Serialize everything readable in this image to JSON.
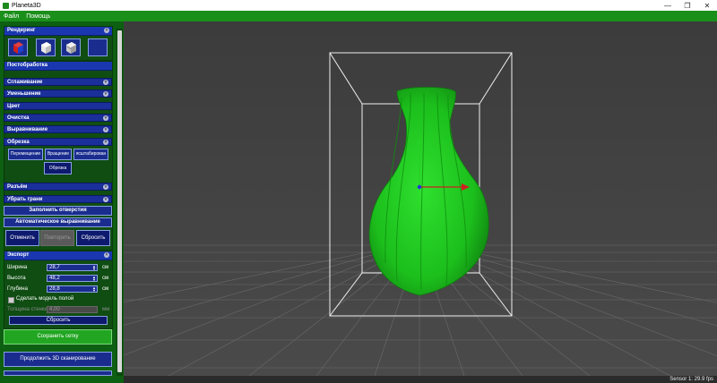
{
  "window": {
    "title": "Planeta3D",
    "minimize": "—",
    "maximize": "❐",
    "close": "✕"
  },
  "menu": {
    "items": [
      "Файл",
      "Помощь"
    ]
  },
  "render": {
    "header": "Рендеринг",
    "icons": [
      "cube-red-blue-icon",
      "cube-white-icon",
      "cube-textured-icon",
      "blank-square-icon"
    ]
  },
  "postprocess": {
    "header": "Постобработка"
  },
  "sections": {
    "smoothing": "Сглаживание",
    "reduction": "Уменьшение",
    "color": "Цвет",
    "cleanup": "Очистка",
    "alignment": "Выравнивание",
    "cropping": "Обрезка",
    "split": "Разъём",
    "remove_faces": "Убрать грани"
  },
  "crop_tools": {
    "move": "Перемещение",
    "rotate": "Вращение",
    "scale": "ясштабирован",
    "apply": "Обрезка"
  },
  "actions": {
    "fill_holes": "Заполнить отверстия",
    "auto_align": "Автоматическое выравнивание",
    "undo": "Отменить",
    "redo": "Повторить",
    "reset": "Сбросить"
  },
  "export": {
    "header": "Экспорт",
    "width_label": "Ширина",
    "width_value": "28,7",
    "height_label": "Высота",
    "height_value": "48,2",
    "depth_label": "Глубина",
    "depth_value": "28,8",
    "unit": "см",
    "hollow_label": "Сделать модель полой",
    "wall_label": "Толщина стенки",
    "wall_value": "4,00",
    "wall_unit": "мм",
    "reset": "Сбросить"
  },
  "save_mesh": "Сохранить сетку",
  "continue_scan": "Продолжить 3D сканирование",
  "status": "Sensor 1: 29.9 fps",
  "colors": {
    "brand_green": "#1a8f1a",
    "panel_blue": "#1a37b0",
    "model_green": "#1ec41e",
    "viewport_bg": "#404040"
  }
}
